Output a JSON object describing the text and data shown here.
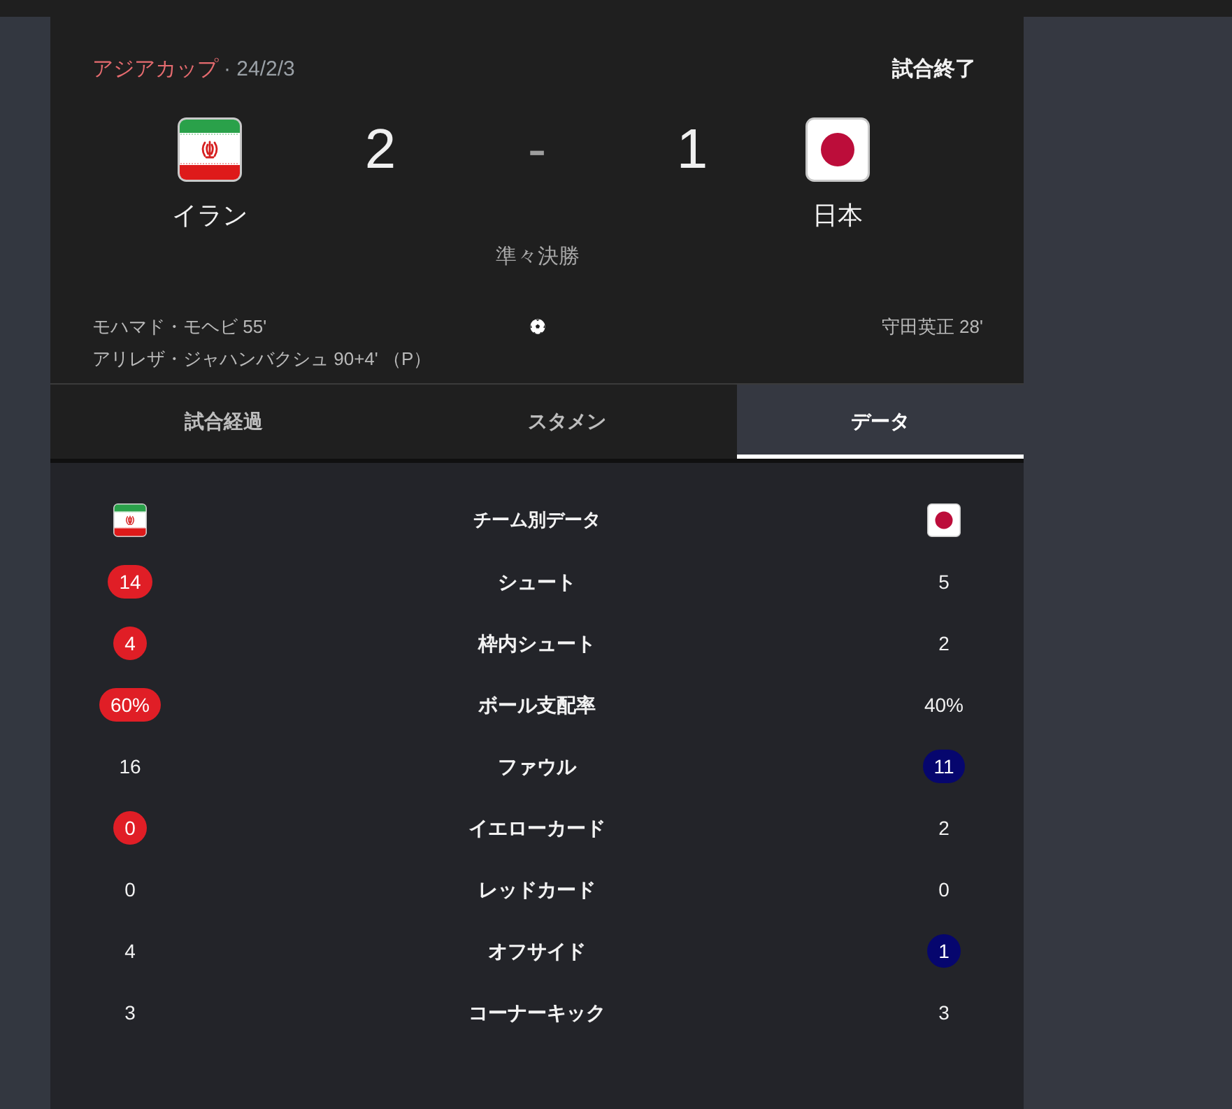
{
  "header": {
    "competition": "アジアカップ",
    "date": "· 24/2/3",
    "status": "試合終了"
  },
  "teams": [
    {
      "name": "イラン",
      "kind": "iran"
    },
    {
      "name": "日本",
      "kind": "japan"
    }
  ],
  "score": {
    "home": "2",
    "separator": "-",
    "away": "1"
  },
  "round": "準々決勝",
  "goals": {
    "home": [
      "モハマド・モヘビ 55'",
      "アリレザ・ジャハンバクシュ 90+4' （P）"
    ],
    "away": [
      "守田英正 28'"
    ]
  },
  "tabs": [
    {
      "label": "試合経過",
      "selected": false
    },
    {
      "label": "スタメン",
      "selected": false
    },
    {
      "label": "データ",
      "selected": true
    }
  ],
  "stats": {
    "title": "チーム別データ",
    "rows": [
      {
        "label": "シュート",
        "home": {
          "value": "14",
          "highlighted": true
        },
        "away": {
          "value": "5",
          "highlighted": false
        }
      },
      {
        "label": "枠内シュート",
        "home": {
          "value": "4",
          "highlighted": true
        },
        "away": {
          "value": "2",
          "highlighted": false
        }
      },
      {
        "label": "ボール支配率",
        "home": {
          "value": "60%",
          "highlighted": true
        },
        "away": {
          "value": "40%",
          "highlighted": false
        }
      },
      {
        "label": "ファウル",
        "home": {
          "value": "16",
          "highlighted": false
        },
        "away": {
          "value": "11",
          "highlighted": true
        }
      },
      {
        "label": "イエローカード",
        "home": {
          "value": "0",
          "highlighted": true
        },
        "away": {
          "value": "2",
          "highlighted": false
        }
      },
      {
        "label": "レッドカード",
        "home": {
          "value": "0",
          "highlighted": false
        },
        "away": {
          "value": "0",
          "highlighted": false
        }
      },
      {
        "label": "オフサイド",
        "home": {
          "value": "4",
          "highlighted": false
        },
        "away": {
          "value": "1",
          "highlighted": true
        }
      },
      {
        "label": "コーナーキック",
        "home": {
          "value": "3",
          "highlighted": false
        },
        "away": {
          "value": "3",
          "highlighted": false
        }
      }
    ]
  }
}
